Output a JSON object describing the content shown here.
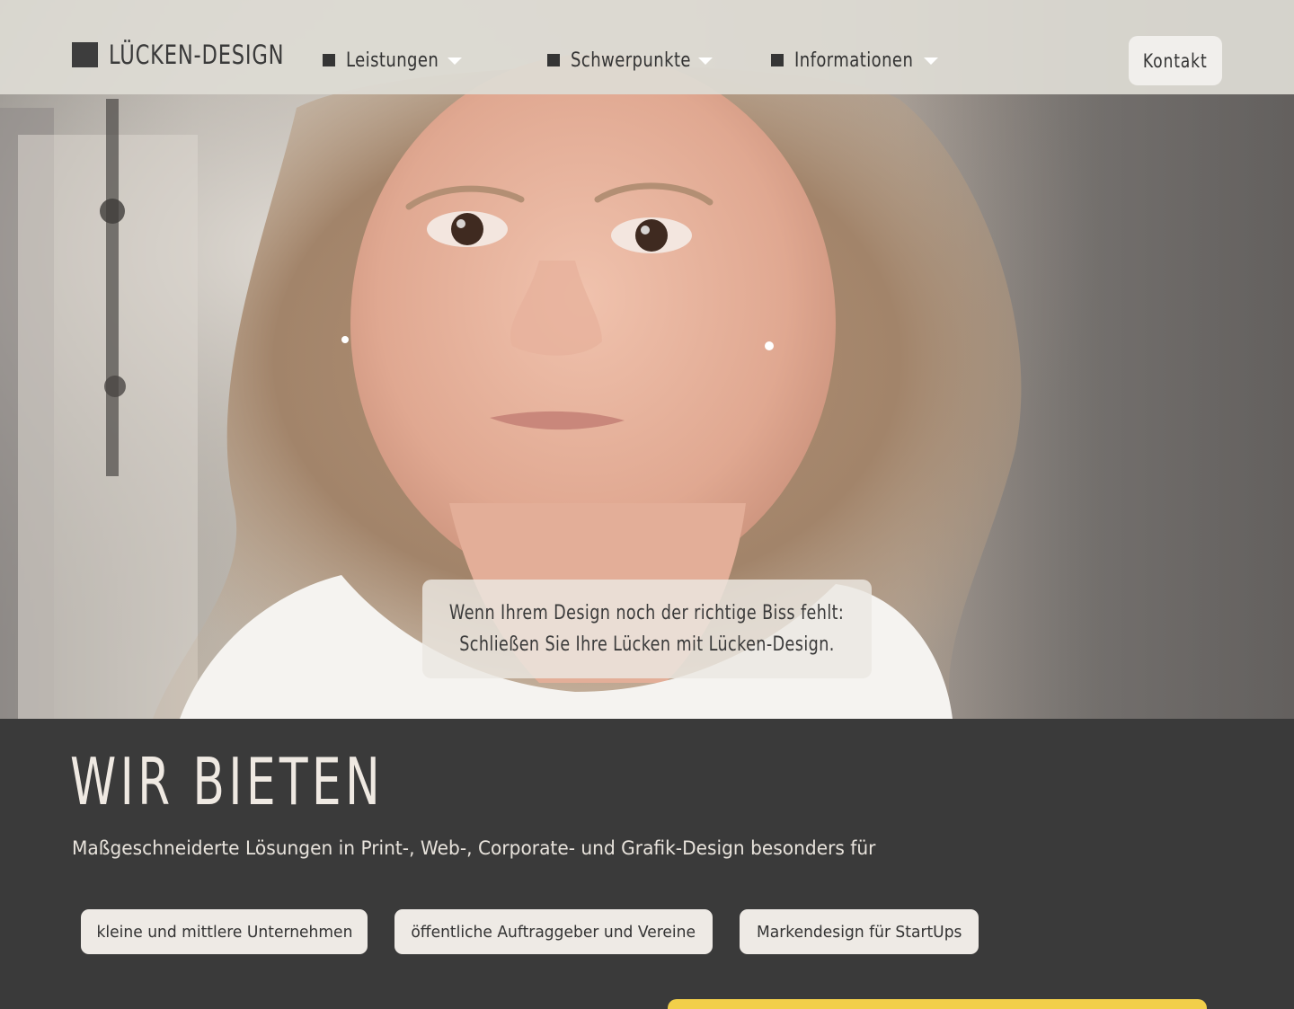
{
  "brand": {
    "logo_text": "LÜCKEN-DESIGN"
  },
  "nav": {
    "items": [
      {
        "label": "Leistungen"
      },
      {
        "label": "Schwerpunkte"
      },
      {
        "label": "Informationen"
      }
    ],
    "contact_label": "Kontakt"
  },
  "hero": {
    "image_description": "portrait-girl",
    "tagline_line1": "Wenn Ihrem Design noch der richtige Biss fehlt:",
    "tagline_line2": "Schließen Sie Ihre Lücken mit Lücken-Design."
  },
  "section": {
    "title": "WIR BIETEN",
    "text": "Maßgeschneiderte Lösungen in Print-, Web-, Corporate- und Grafik-Design besonders für",
    "pills": [
      {
        "label": "kleine und mittlere Unternehmen"
      },
      {
        "label": "öffentliche Auftraggeber und Vereine"
      },
      {
        "label": "Markendesign für StartUps"
      }
    ]
  },
  "colors": {
    "dark_bg": "#3a3a3a",
    "nav_bg": "#dedbd4",
    "pill_bg": "#eeeae5",
    "accent_yellow": "#f2cf4a"
  }
}
